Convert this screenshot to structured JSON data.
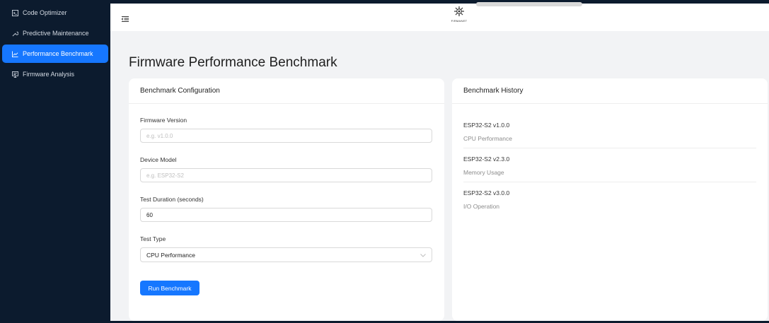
{
  "sidebar": {
    "items": [
      {
        "label": "Code Optimizer",
        "icon": "code-icon"
      },
      {
        "label": "Predictive Maintenance",
        "icon": "tool-icon"
      },
      {
        "label": "Performance Benchmark",
        "icon": "line-chart-icon",
        "active": true
      },
      {
        "label": "Firmware Analysis",
        "icon": "desktop-icon"
      }
    ]
  },
  "header": {
    "logo_text": "FIRMANET"
  },
  "page": {
    "title": "Firmware Performance Benchmark"
  },
  "config": {
    "title": "Benchmark Configuration",
    "firmware_version": {
      "label": "Firmware Version",
      "placeholder": "e.g. v1.0.0",
      "value": ""
    },
    "device_model": {
      "label": "Device Model",
      "placeholder": "e.g. ESP32-S2",
      "value": ""
    },
    "test_duration": {
      "label": "Test Duration (seconds)",
      "value": "60"
    },
    "test_type": {
      "label": "Test Type",
      "value": "CPU Performance"
    },
    "run_label": "Run Benchmark"
  },
  "history": {
    "title": "Benchmark History",
    "items": [
      {
        "title": "ESP32-S2 v1.0.0",
        "subtitle": "CPU Performance"
      },
      {
        "title": "ESP32-S2 v2.3.0",
        "subtitle": "Memory Usage"
      },
      {
        "title": "ESP32-S2 v3.0.0",
        "subtitle": "I/O Operation"
      }
    ]
  },
  "colors": {
    "sidebar_bg": "#0c1b2e",
    "accent": "#1677ff",
    "content_bg": "#f2f3f5"
  }
}
